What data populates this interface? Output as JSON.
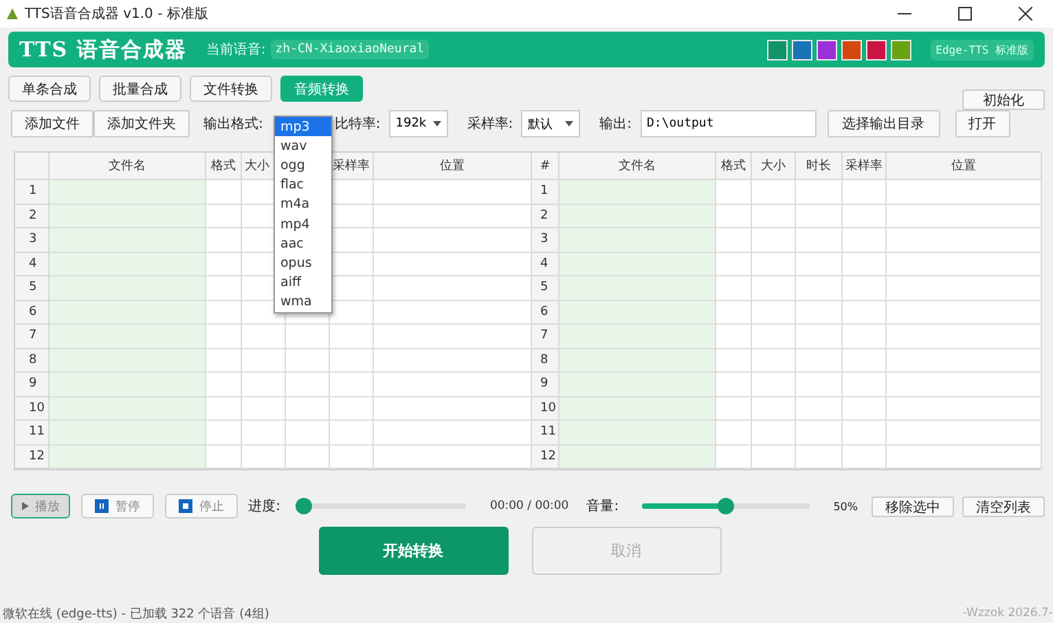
{
  "window": {
    "title": "TTS语音合成器 v1.0 - 标准版"
  },
  "header": {
    "app_name": "TTS 语音合成器",
    "voice_label": "当前语音:",
    "voice": "zh-CN-XiaoxiaoNeural",
    "theme_colors": [
      {
        "color": "#12946a"
      },
      {
        "color": "#1a73b5"
      },
      {
        "color": "#9b30d9"
      },
      {
        "color": "#d4480f"
      },
      {
        "color": "#cc1444"
      },
      {
        "color": "#6aa312"
      }
    ],
    "edition": "Edge-TTS 标准版"
  },
  "tabs": [
    {
      "label": "单条合成",
      "selected": false
    },
    {
      "label": "批量合成",
      "selected": false
    },
    {
      "label": "文件转换",
      "selected": false
    },
    {
      "label": "音频转换",
      "selected": true
    }
  ],
  "reset_button": "初始化",
  "toolbar": {
    "add_file": "添加文件",
    "add_folder": "添加文件夹",
    "format_label": "输出格式:",
    "bitrate_label": "比特率:",
    "bitrate": "192k",
    "samplerate_label": "采样率:",
    "samplerate": "默认",
    "output_label": "输出:",
    "output_path": "D:\\output",
    "choose_dir": "选择输出目录",
    "open": "打开"
  },
  "format_dropdown": [
    {
      "label": "mp3",
      "selected": true
    },
    {
      "label": "wav",
      "selected": false
    },
    {
      "label": "ogg",
      "selected": false
    },
    {
      "label": "flac",
      "selected": false
    },
    {
      "label": "m4a",
      "selected": false
    },
    {
      "label": "mp4",
      "selected": false
    },
    {
      "label": "aac",
      "selected": false
    },
    {
      "label": "opus",
      "selected": false
    },
    {
      "label": "aiff",
      "selected": false
    },
    {
      "label": "wma",
      "selected": false
    }
  ],
  "tables": [
    {
      "columns": [
        "文件名",
        "格式",
        "大小",
        "",
        "采样率",
        "位置"
      ],
      "rows": [
        "1",
        "2",
        "3",
        "4",
        "5",
        "6",
        "7",
        "8",
        "9",
        "10",
        "11",
        "12"
      ]
    },
    {
      "corner": "#",
      "columns": [
        "文件名",
        "格式",
        "大小",
        "时长",
        "采样率",
        "位置"
      ],
      "rows": [
        "1",
        "2",
        "3",
        "4",
        "5",
        "6",
        "7",
        "8",
        "9",
        "10",
        "11",
        "12"
      ]
    }
  ],
  "player": {
    "play": {
      "label": "播放",
      "selected": true
    },
    "pause": {
      "label": "暂停",
      "selected": false
    },
    "stop": {
      "label": "停止",
      "selected": false
    },
    "progress_label": "进度:",
    "progress": {
      "level": 0
    },
    "time": "00:00 / 00:00",
    "volume_label": "音量:",
    "volume": {
      "level": 0.5
    },
    "volume_reading": "50%",
    "remove_selected": "移除选中",
    "clear_list": "清空列表"
  },
  "actions": [
    {
      "label": "开始转换",
      "kind": "primary",
      "disabled": false
    },
    {
      "label": "取消",
      "kind": "secondary",
      "disabled": true
    }
  ],
  "status_bar": {
    "text": "微软在线 (edge-tts) - 已加载 322 个语音 (4组)",
    "credit": "-Wzzok 2026.7-"
  }
}
